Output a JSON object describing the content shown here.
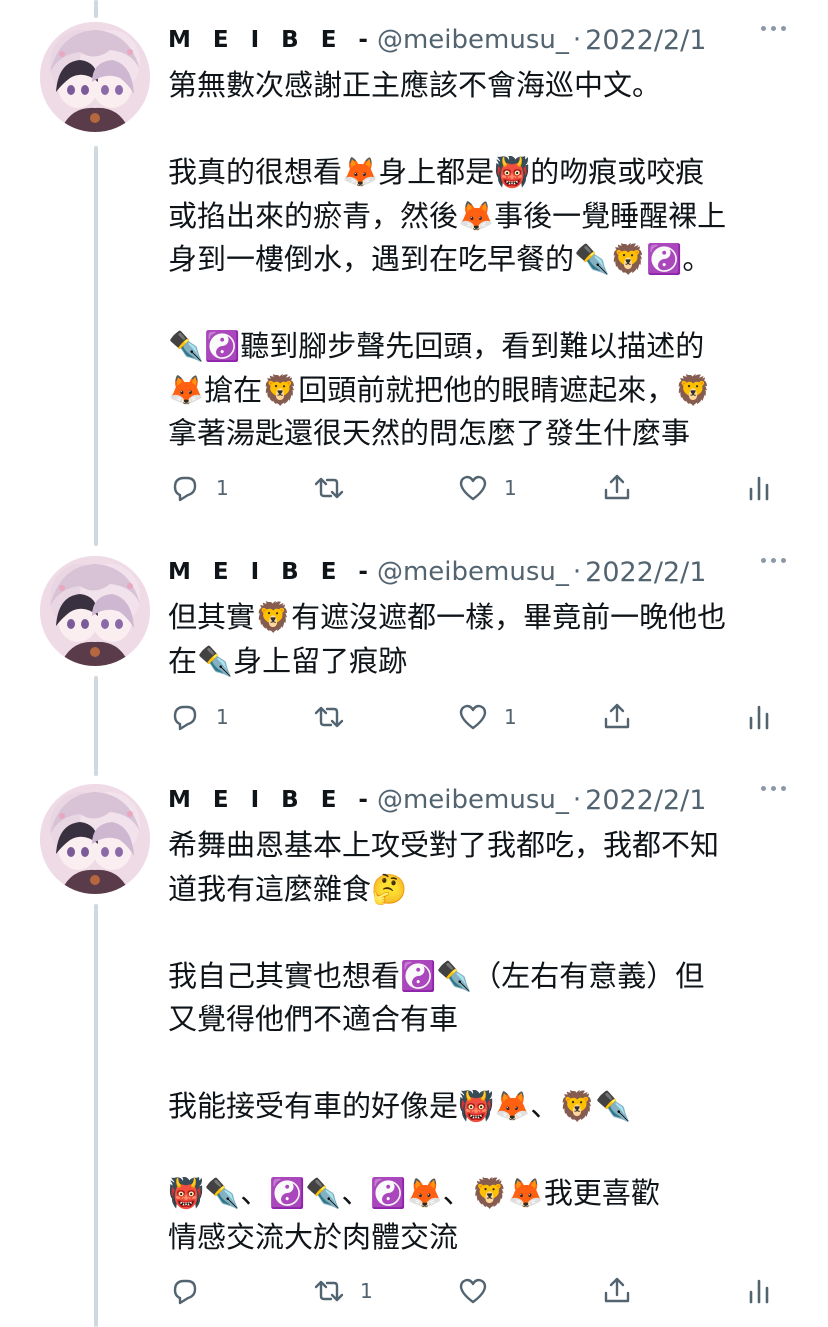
{
  "tweets": [
    {
      "author_name": "M E I B E -",
      "handle": "@meibemusu_",
      "separator": "·",
      "date": "2022/2/1",
      "body_lines": [
        "第無數次感謝正主應該不會海巡中文。",
        "",
        "我真的很想看🦊身上都是👹的吻痕或咬痕",
        "或掐出來的瘀青，然後🦊事後一覺睡醒裸上",
        "身到一樓倒水，遇到在吃早餐的✒️🦁☯️。",
        "",
        "✒️☯️聽到腳步聲先回頭，看到難以描述的",
        "🦊搶在🦁回頭前就把他的眼睛遮起來，🦁",
        "拿著湯匙還很天然的問怎麼了發生什麼事"
      ],
      "reply_count": "1",
      "retweet_count": "",
      "like_count": "1"
    },
    {
      "author_name": "M E I B E -",
      "handle": "@meibemusu_",
      "separator": "·",
      "date": "2022/2/1",
      "body_lines": [
        "但其實🦁有遮沒遮都一樣，畢竟前一晚他也",
        "在✒️身上留了痕跡"
      ],
      "reply_count": "1",
      "retweet_count": "",
      "like_count": "1"
    },
    {
      "author_name": "M E I B E -",
      "handle": "@meibemusu_",
      "separator": "·",
      "date": "2022/2/1",
      "body_lines": [
        "希舞曲恩基本上攻受對了我都吃，我都不知",
        "道我有這麼雜食🤔",
        "",
        "我自己其實也想看☯️✒️（左右有意義）但",
        "又覺得他們不適合有車",
        "",
        "我能接受有車的好像是👹🦊、🦁✒️",
        "",
        "👹✒️、☯️✒️、☯️🦊、🦁🦊我更喜歡",
        "情感交流大於肉體交流"
      ],
      "reply_count": "",
      "retweet_count": "1",
      "like_count": ""
    }
  ],
  "icons": {
    "reply": "reply-icon",
    "retweet": "retweet-icon",
    "like": "heart-icon",
    "share": "share-icon",
    "analytics": "analytics-icon",
    "more": "more-icon"
  },
  "colors": {
    "text": "#0f1419",
    "secondary": "#536471",
    "thread_line": "#cfd9de"
  }
}
